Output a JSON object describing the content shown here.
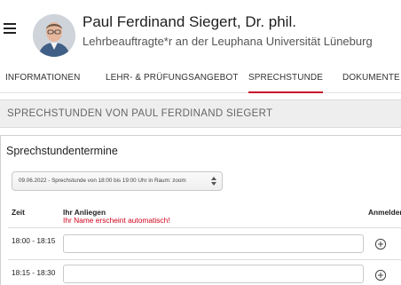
{
  "profile": {
    "name": "Paul Ferdinand Siegert, Dr. phil.",
    "subtitle": "Lehrbeauftragte*r an der Leuphana Universität Lüneburg"
  },
  "tabs": [
    {
      "label": "INFORMATIONEN",
      "active": false
    },
    {
      "label": "LEHR- & PRÜFUNGSANGEBOT",
      "active": false
    },
    {
      "label": "SPRECHSTUNDE",
      "active": true
    },
    {
      "label": "DOKUMENTE",
      "active": false
    }
  ],
  "banner": {
    "title": "SPRECHSTUNDEN VON PAUL FERDINAND SIEGERT"
  },
  "section": {
    "title": "Sprechstundentermine",
    "select": {
      "selected": "09.06.2022 - Sprechstunde von 18:00 bis 19:00 Uhr in Raum: zoom"
    },
    "columns": {
      "time": "Zeit",
      "concern": "Ihr Anliegen",
      "register": "Anmelden"
    },
    "hint": "Ihr Name erscheint automatisch!",
    "slots": [
      {
        "time": "18:00 - 18:15",
        "value": ""
      },
      {
        "time": "18:15 - 18:30",
        "value": ""
      }
    ]
  },
  "colors": {
    "accent": "#c8102e",
    "hint": "#d0021b",
    "banner_bg": "#eeeeee"
  },
  "icons": {
    "menu": "hamburger-icon",
    "add": "plus-circle-icon",
    "select": "updown-arrows-icon"
  }
}
